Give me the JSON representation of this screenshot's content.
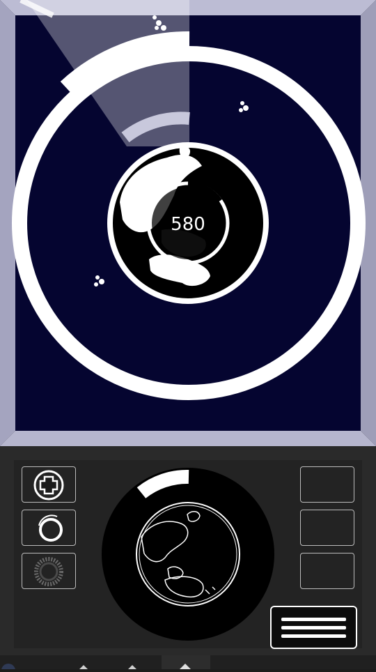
{
  "game": {
    "score": "580"
  },
  "colors": {
    "space_background": "#050530",
    "frame": "#a7a7c4",
    "ring": "#ffffff",
    "panel": "#2a2a2a"
  },
  "icons": {
    "ability_1": "heal-cross-icon",
    "ability_2": "rotate-ring-icon",
    "ability_3": "shield-ring-icon",
    "menu": "hamburger-menu-icon"
  }
}
